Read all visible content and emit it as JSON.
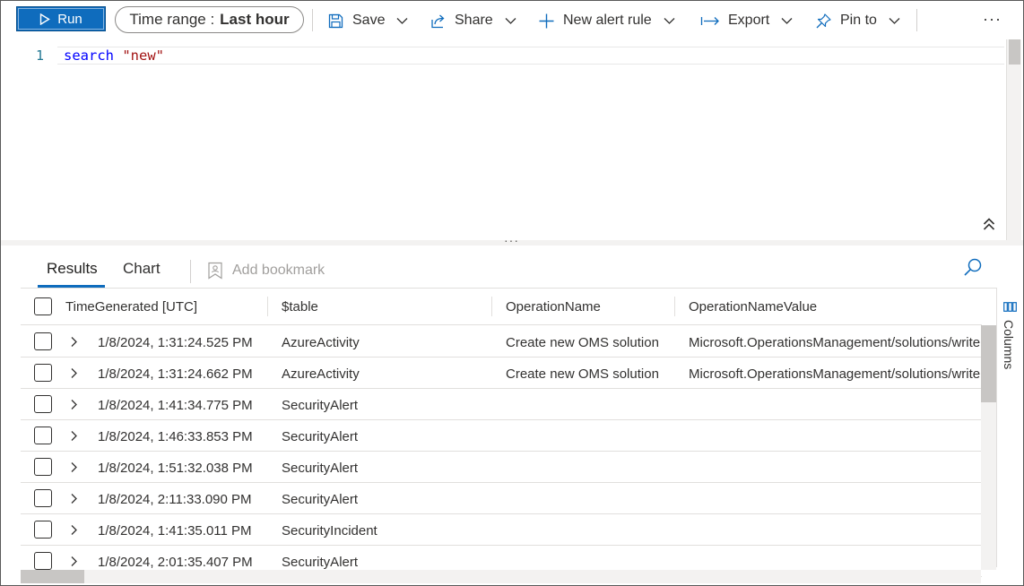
{
  "toolbar": {
    "run_label": "Run",
    "time_range_label": "Time range :",
    "time_range_value": "Last hour",
    "save_label": "Save",
    "share_label": "Share",
    "new_alert_label": "New alert rule",
    "export_label": "Export",
    "pin_label": "Pin to",
    "more_label": "···"
  },
  "editor": {
    "line_number": "1",
    "keyword": "search",
    "string_literal": "\"new\""
  },
  "splitter": {
    "handle": "···"
  },
  "results": {
    "tabs": [
      {
        "label": "Results",
        "selected": true
      },
      {
        "label": "Chart",
        "selected": false
      }
    ],
    "bookmark_label": "Add bookmark",
    "columns_label": "Columns",
    "headers": [
      "TimeGenerated [UTC]",
      "$table",
      "OperationName",
      "OperationNameValue"
    ],
    "rows": [
      {
        "time": "1/8/2024, 1:31:24.525 PM",
        "table": "AzureActivity",
        "operation": "Create new OMS solution",
        "operation_value": "Microsoft.OperationsManagement/solutions/write"
      },
      {
        "time": "1/8/2024, 1:31:24.662 PM",
        "table": "AzureActivity",
        "operation": "Create new OMS solution",
        "operation_value": "Microsoft.OperationsManagement/solutions/write"
      },
      {
        "time": "1/8/2024, 1:41:34.775 PM",
        "table": "SecurityAlert",
        "operation": "",
        "operation_value": ""
      },
      {
        "time": "1/8/2024, 1:46:33.853 PM",
        "table": "SecurityAlert",
        "operation": "",
        "operation_value": ""
      },
      {
        "time": "1/8/2024, 1:51:32.038 PM",
        "table": "SecurityAlert",
        "operation": "",
        "operation_value": ""
      },
      {
        "time": "1/8/2024, 2:11:33.090 PM",
        "table": "SecurityAlert",
        "operation": "",
        "operation_value": ""
      },
      {
        "time": "1/8/2024, 1:41:35.011 PM",
        "table": "SecurityIncident",
        "operation": "",
        "operation_value": ""
      },
      {
        "time": "1/8/2024, 2:01:35.407 PM",
        "table": "SecurityAlert",
        "operation": "",
        "operation_value": ""
      }
    ]
  },
  "colors": {
    "accent": "#0f6cbd",
    "keyword": "#0000ff",
    "string": "#a31515",
    "line_number": "#237893"
  },
  "icons": [
    "play-icon",
    "save-icon",
    "share-icon",
    "plus-icon",
    "export-icon",
    "pin-icon",
    "chevron-down-icon",
    "bookmark-icon",
    "search-icon",
    "columns-icon",
    "chevron-right-icon",
    "double-chevron-up-icon"
  ]
}
